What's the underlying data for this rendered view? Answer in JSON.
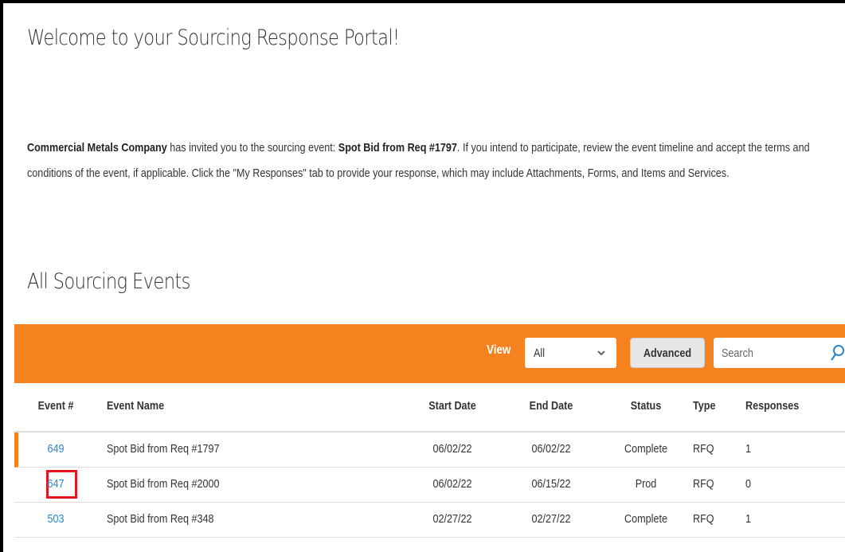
{
  "welcome_title": "Welcome to your Sourcing Response Portal!",
  "intro": {
    "company": "Commercial Metals Company",
    "text1": " has invited you to the sourcing event: ",
    "event": "Spot Bid from Req #1797",
    "text2": ". If you intend to participate, review the event timeline and accept the terms and conditions of the event, if applicable. Click the \"My Responses\" tab to provide your response, which may include Attachments, Forms, and Items and Services."
  },
  "section_title": "All Sourcing Events",
  "toolbar": {
    "view_label": "View",
    "view_value": "All",
    "advanced_label": "Advanced",
    "search_placeholder": "Search"
  },
  "columns": {
    "event_num": "Event #",
    "event_name": "Event Name",
    "start_date": "Start Date",
    "end_date": "End Date",
    "status": "Status",
    "type": "Type",
    "responses": "Responses"
  },
  "rows": [
    {
      "num": "649",
      "name": "Spot Bid from Req #1797",
      "start": "06/02/22",
      "end": "06/02/22",
      "status": "Complete",
      "type": "RFQ",
      "responses": "1"
    },
    {
      "num": "647",
      "name": "Spot Bid from Req #2000",
      "start": "06/02/22",
      "end": "06/15/22",
      "status": "Prod",
      "type": "RFQ",
      "responses": "0"
    },
    {
      "num": "503",
      "name": "Spot Bid from Req #348",
      "start": "02/27/22",
      "end": "02/27/22",
      "status": "Complete",
      "type": "RFQ",
      "responses": "1"
    }
  ],
  "colors": {
    "accent": "#f5821f",
    "link": "#2a88c8",
    "highlight": "#e5141f"
  }
}
